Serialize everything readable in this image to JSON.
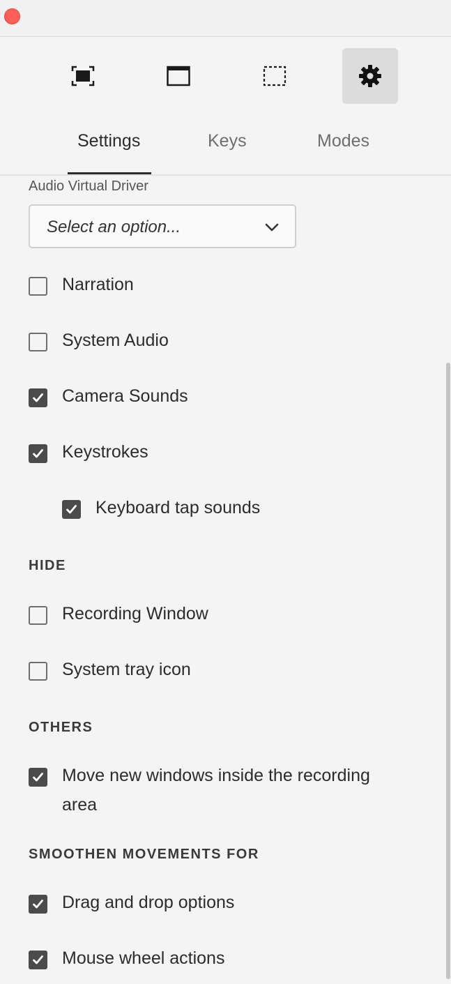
{
  "window": {
    "close_button": "close"
  },
  "toolbar": {
    "buttons": [
      {
        "icon": "fullscreen-capture-icon",
        "active": false
      },
      {
        "icon": "window-capture-icon",
        "active": false
      },
      {
        "icon": "region-capture-icon",
        "active": false
      },
      {
        "icon": "gear-icon",
        "active": true
      }
    ]
  },
  "tabs": [
    {
      "label": "Settings",
      "selected": true
    },
    {
      "label": "Keys",
      "selected": false
    },
    {
      "label": "Modes",
      "selected": false
    }
  ],
  "audio": {
    "label": "Audio Virtual Driver",
    "select_placeholder": "Select an option..."
  },
  "checkboxes": {
    "narration": {
      "label": "Narration",
      "checked": false
    },
    "system_audio": {
      "label": "System Audio",
      "checked": false
    },
    "camera_sounds": {
      "label": "Camera Sounds",
      "checked": true
    },
    "keystrokes": {
      "label": "Keystrokes",
      "checked": true
    },
    "keyboard_tap_sounds": {
      "label": "Keyboard tap sounds",
      "checked": true
    },
    "recording_window": {
      "label": "Recording Window",
      "checked": false
    },
    "system_tray_icon": {
      "label": "System tray icon",
      "checked": false
    },
    "move_new_windows": {
      "label": "Move new windows inside the recording area",
      "checked": true
    },
    "drag_and_drop": {
      "label": "Drag and drop options",
      "checked": true
    },
    "mouse_wheel": {
      "label": "Mouse wheel actions",
      "checked": true
    }
  },
  "sections": {
    "hide": "HIDE",
    "others": "OTHERS",
    "smoothen": "SMOOTHEN MOVEMENTS FOR"
  },
  "colors": {
    "accent": "#2c2c2c",
    "checkbox_checked": "#4b4b4b",
    "close": "#fe5f57"
  }
}
